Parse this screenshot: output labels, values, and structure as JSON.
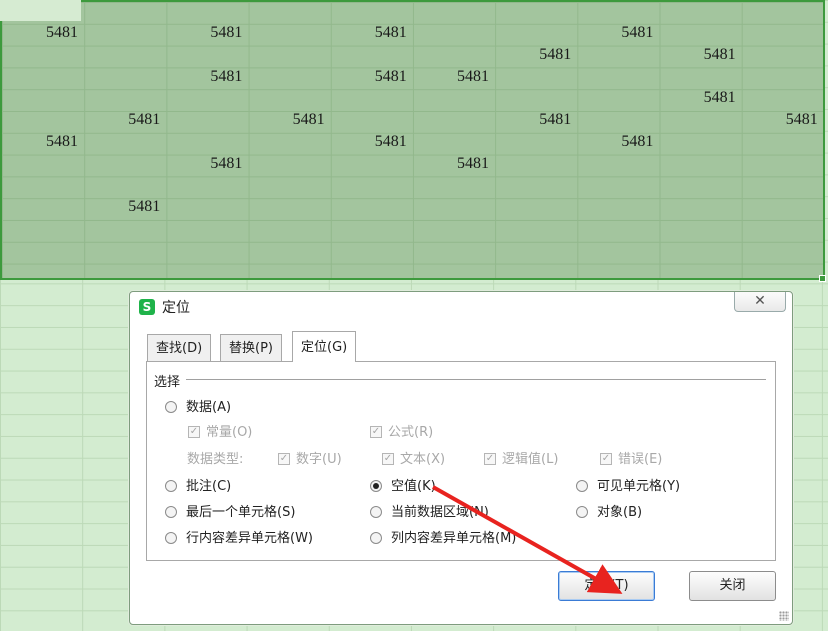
{
  "sheet": {
    "cell_value": "5481",
    "cells": [
      [
        0,
        0
      ],
      [
        0,
        2
      ],
      [
        0,
        4
      ],
      [
        0,
        7
      ],
      [
        1,
        6
      ],
      [
        1,
        8
      ],
      [
        2,
        2
      ],
      [
        2,
        4
      ],
      [
        2,
        5
      ],
      [
        3,
        8
      ],
      [
        4,
        1
      ],
      [
        4,
        3
      ],
      [
        4,
        6
      ],
      [
        4,
        9
      ],
      [
        5,
        0
      ],
      [
        5,
        4
      ],
      [
        5,
        7
      ],
      [
        6,
        2
      ],
      [
        6,
        5
      ],
      [
        8,
        1
      ]
    ]
  },
  "dialog": {
    "title": "定位",
    "logo_letter": "S",
    "close_glyph": "✕",
    "tabs": [
      {
        "label": "查找(D)",
        "active": false
      },
      {
        "label": "替换(P)",
        "active": false
      },
      {
        "label": "定位(G)",
        "active": true
      }
    ],
    "group_label": "选择",
    "options": {
      "data": {
        "label": "数据(A)",
        "checked": false
      },
      "constants": {
        "label": "常量(O)",
        "checked": true,
        "enabled": false
      },
      "formulas": {
        "label": "公式(R)",
        "checked": true,
        "enabled": false
      },
      "data_types_label": "数据类型:",
      "numbers": {
        "label": "数字(U)",
        "checked": true,
        "enabled": false
      },
      "text": {
        "label": "文本(X)",
        "checked": true,
        "enabled": false
      },
      "logicals": {
        "label": "逻辑值(L)",
        "checked": true,
        "enabled": false
      },
      "errors": {
        "label": "错误(E)",
        "checked": true,
        "enabled": false
      },
      "comments": {
        "label": "批注(C)",
        "checked": false
      },
      "blanks": {
        "label": "空值(K)",
        "checked": true
      },
      "visible_cells": {
        "label": "可见单元格(Y)",
        "checked": false
      },
      "last_cell": {
        "label": "最后一个单元格(S)",
        "checked": false
      },
      "current_region": {
        "label": "当前数据区域(N)",
        "checked": false
      },
      "objects": {
        "label": "对象(B)",
        "checked": false
      },
      "row_differences": {
        "label": "行内容差异单元格(W)",
        "checked": false
      },
      "column_differences": {
        "label": "列内容差异单元格(M)",
        "checked": false
      }
    },
    "buttons": {
      "locate": "定位(T)",
      "close": "关闭"
    }
  },
  "annotation": {
    "arrow_color": "#e8231f"
  }
}
